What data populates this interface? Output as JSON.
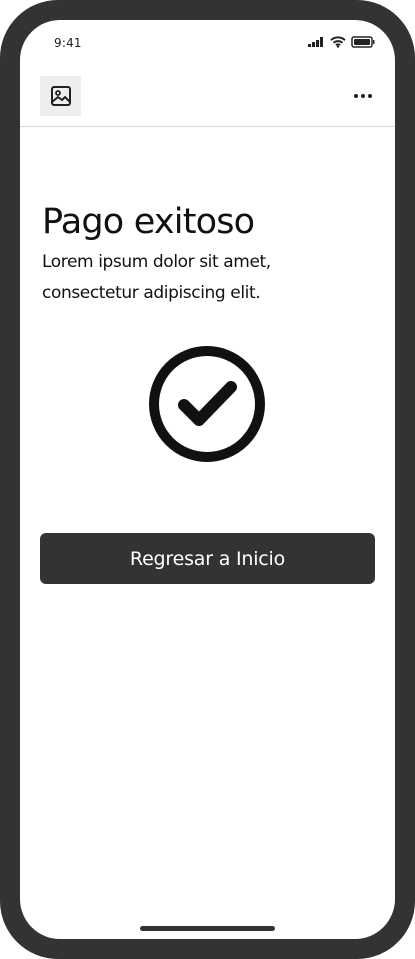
{
  "status_bar": {
    "time": "9:41",
    "signal_icon": "cellular-signal-icon",
    "wifi_icon": "wifi-icon",
    "battery_icon": "battery-icon"
  },
  "app_bar": {
    "left_icon": "image-icon",
    "right_icon": "more-horizontal-icon"
  },
  "content": {
    "title": "Pago exitoso",
    "description": "Lorem ipsum dolor sit amet, consectetur adipiscing elit.",
    "status_icon": "check-circle-icon"
  },
  "actions": {
    "primary_label": "Regresar a Inicio"
  },
  "colors": {
    "frame": "#333333",
    "screen": "#ffffff",
    "text": "#111111",
    "button": "#333333",
    "button_text": "#ffffff",
    "divider": "#d7d7d7"
  }
}
